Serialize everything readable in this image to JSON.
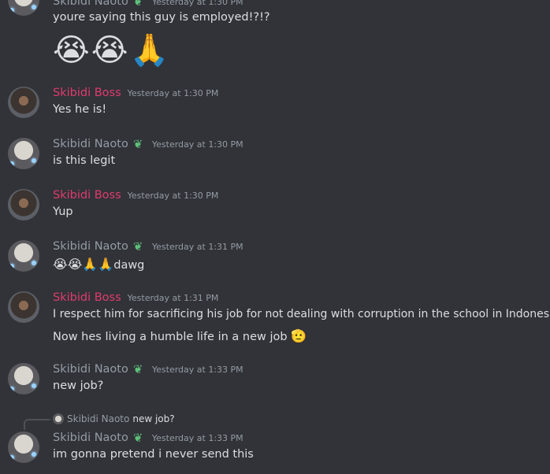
{
  "users": {
    "naoto": "Skibidi Naoto",
    "boss": "Skibidi Boss"
  },
  "messages": [
    {
      "user": "Skibidi Naoto",
      "time": "Yesterday at 1:30 PM",
      "text": "youre saying this guy is employed!?!?",
      "emoji": "😭😭🙏"
    },
    {
      "user": "Skibidi Boss",
      "time": "Yesterday at 1:30 PM",
      "text": "Yes he is!"
    },
    {
      "user": "Skibidi Naoto",
      "time": "Yesterday at 1:30 PM",
      "text": "is this legit"
    },
    {
      "user": "Skibidi Boss",
      "time": "Yesterday at 1:30 PM",
      "text": "Yup"
    },
    {
      "user": "Skibidi Naoto",
      "time": "Yesterday at 1:31 PM",
      "emoji": "😭😭🙏🙏",
      "text": "dawg"
    },
    {
      "user": "Skibidi Boss",
      "time": "Yesterday at 1:31 PM",
      "text": "I respect him for sacrificing his job for not dealing with corruption in the school in Indonesia",
      "text2": "Now hes living a humble life in a new job",
      "emoji2": "🫡"
    },
    {
      "user": "Skibidi Naoto",
      "time": "Yesterday at 1:33 PM",
      "text": "new job?"
    },
    {
      "user": "Skibidi Naoto",
      "time": "Yesterday at 1:33 PM",
      "reply_user": "Skibidi Naoto",
      "reply_text": "new job?",
      "text": "im gonna pretend i never send this"
    }
  ],
  "icons": {
    "badge": "nitro-leaf-badge-icon",
    "colors": {
      "background": "#313338",
      "boss": "#e23a6d",
      "muted": "#949ba4",
      "text": "#dbdee1",
      "badge": "#5fbf7a"
    }
  }
}
